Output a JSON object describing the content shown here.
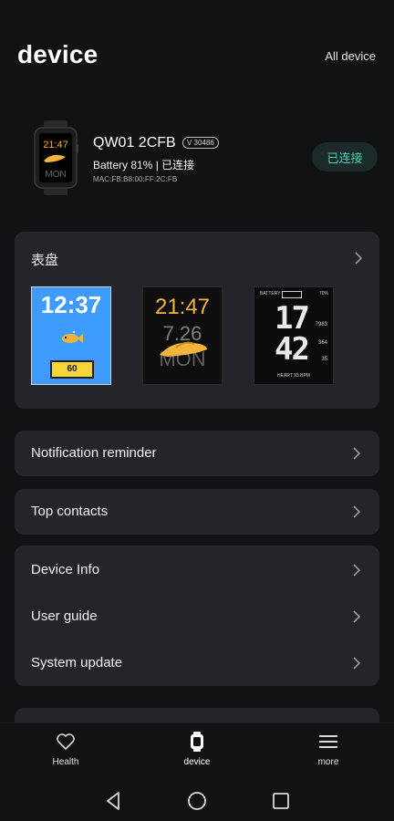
{
  "header": {
    "title": "device",
    "all_device_label": "All device"
  },
  "device": {
    "name": "QW01 2CFB",
    "version": "V 30486",
    "battery_line": "Battery  81% | 已连接",
    "battery_percent": 81,
    "mac": "MAC:FB:B8:00:FF:2C:FB",
    "status_button": "已连接",
    "watch_preview": {
      "time": "21:47",
      "day": "MON"
    }
  },
  "watchface": {
    "title": "表盘",
    "faces": [
      {
        "time": "12:37",
        "badge": "60"
      },
      {
        "time": "21:47",
        "date": "7.26",
        "day": "MON"
      },
      {
        "battery_label": "BATTERY",
        "battery_pct": "70%",
        "hour": "17",
        "minute": "42",
        "side_values": [
          "7983",
          "364",
          "35"
        ],
        "bottom": "HEART  93  BPM"
      }
    ]
  },
  "menu": {
    "notification_reminder": "Notification reminder",
    "top_contacts": "Top contacts",
    "device_info": "Device Info",
    "user_guide": "User guide",
    "system_update": "System update"
  },
  "bottom_nav": {
    "items": [
      {
        "label": "Health",
        "icon": "heart-icon",
        "active": false
      },
      {
        "label": "device",
        "icon": "watch-icon",
        "active": true
      },
      {
        "label": "more",
        "icon": "menu-icon",
        "active": false
      }
    ]
  },
  "system_nav": {
    "back": "back-icon",
    "home": "home-icon",
    "recents": "recents-icon"
  },
  "colors": {
    "background": "#111214",
    "card": "#23252a",
    "accent": "#47d1b4",
    "text": "#f3f3f3"
  }
}
